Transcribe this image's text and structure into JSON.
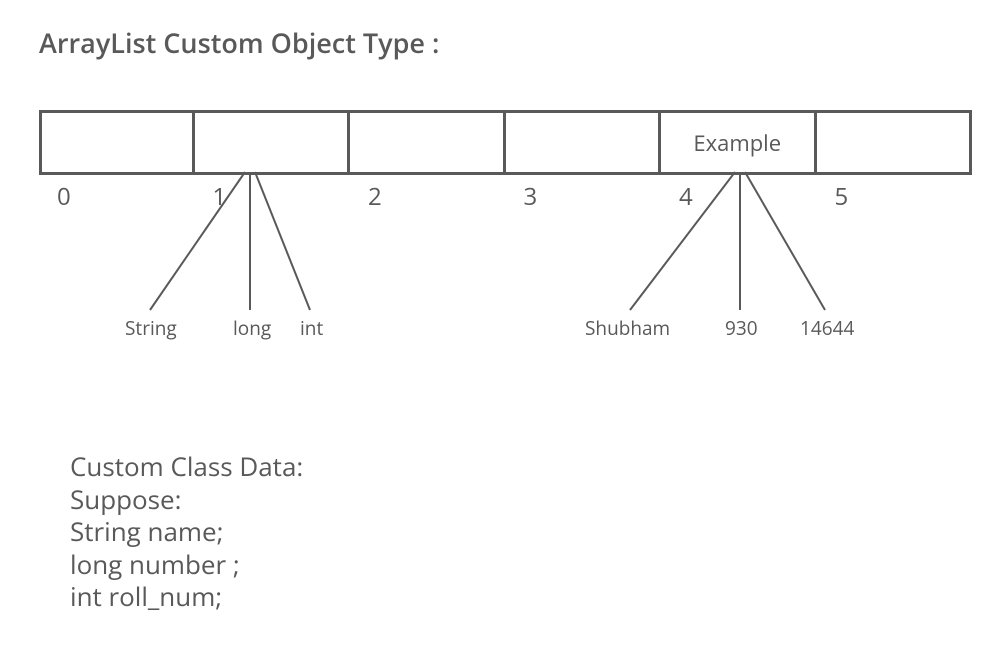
{
  "title": "ArrayList Custom Object Type :",
  "array": {
    "cells": [
      {
        "content": ""
      },
      {
        "content": ""
      },
      {
        "content": ""
      },
      {
        "content": ""
      },
      {
        "content": "Example"
      },
      {
        "content": ""
      }
    ],
    "indices": [
      "0",
      "1",
      "2",
      "3",
      "4",
      "5"
    ]
  },
  "fan1": {
    "labels": [
      "String",
      "long",
      "int"
    ]
  },
  "fan2": {
    "labels": [
      "Shubham",
      "930",
      "14644"
    ]
  },
  "class_data": {
    "line1": "Custom Class Data:",
    "line2": "Suppose:",
    "line3": "String name;",
    "line4": "long number ;",
    "line5": "int roll_num;"
  }
}
